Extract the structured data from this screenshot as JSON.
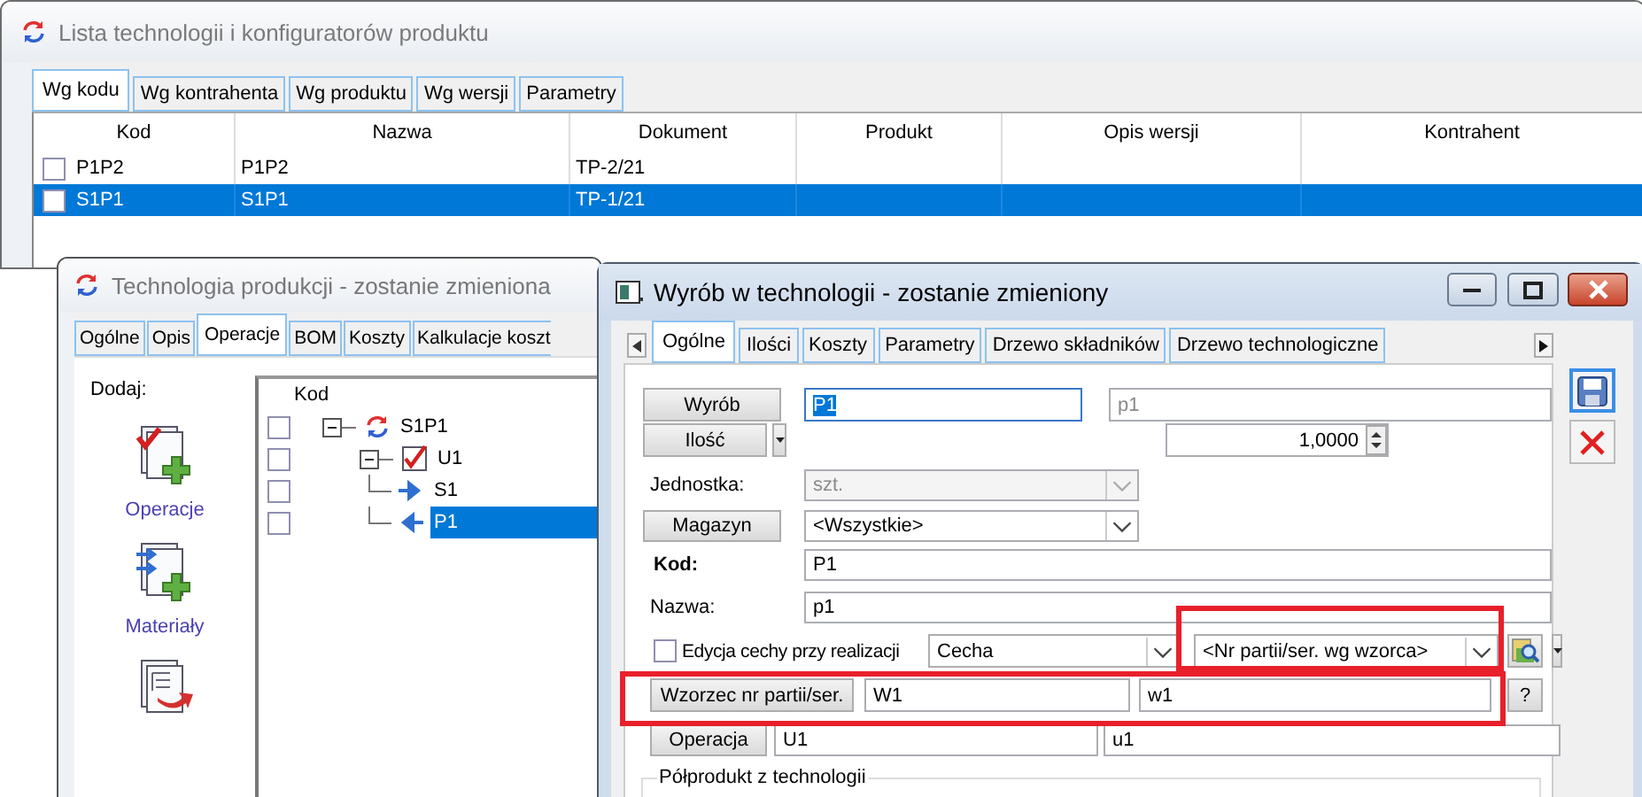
{
  "list_window": {
    "title": "Lista technologii i konfiguratorów produktu",
    "tabs": [
      {
        "label": "Wg kodu",
        "selected": true
      },
      {
        "label": "Wg kontrahenta",
        "selected": false
      },
      {
        "label": "Wg produktu",
        "selected": false
      },
      {
        "label": "Wg wersji",
        "selected": false
      },
      {
        "label": "Parametry",
        "selected": false
      }
    ],
    "table": {
      "columns": [
        "Kod",
        "Nazwa",
        "Dokument",
        "Produkt",
        "Opis wersji",
        "Kontrahent"
      ],
      "rows": [
        {
          "checked": false,
          "selected": false,
          "cells": [
            "P1P2",
            "P1P2",
            "TP-2/21",
            "",
            "",
            ""
          ]
        },
        {
          "checked": false,
          "selected": true,
          "cells": [
            "S1P1",
            "S1P1",
            "TP-1/21",
            "",
            "",
            ""
          ]
        }
      ]
    }
  },
  "technology_window": {
    "title": "Technologia produkcji - zostanie zmieniona",
    "tabs": [
      {
        "label": "Ogólne",
        "selected": false
      },
      {
        "label": "Opis",
        "selected": false
      },
      {
        "label": "Operacje",
        "selected": true
      },
      {
        "label": "BOM",
        "selected": false
      },
      {
        "label": "Koszty",
        "selected": false
      },
      {
        "label": "Kalkulacje koszt",
        "selected": false
      }
    ],
    "add_label": "Dodaj:",
    "add_actions": [
      {
        "kind": "operation",
        "label": "Operacje"
      },
      {
        "kind": "material",
        "label": "Materiały"
      },
      {
        "kind": "report"
      }
    ],
    "tree": {
      "column": "Kod",
      "nodes": [
        {
          "label": "S1P1",
          "kind": "technology",
          "checked": false,
          "selected": false,
          "expanded": true,
          "children": [
            {
              "label": "U1",
              "kind": "operation",
              "checked": false,
              "selected": false,
              "expanded": true,
              "children": [
                {
                  "label": "S1",
                  "kind": "input",
                  "checked": false,
                  "selected": false
                },
                {
                  "label": "P1",
                  "kind": "output",
                  "checked": false,
                  "selected": true
                }
              ]
            }
          ]
        }
      ]
    }
  },
  "product_window": {
    "title": "Wyrób w technologii - zostanie zmieniony",
    "tabs": [
      {
        "label": "Ogólne",
        "selected": true
      },
      {
        "label": "Ilości",
        "selected": false
      },
      {
        "label": "Koszty",
        "selected": false
      },
      {
        "label": "Parametry",
        "selected": false
      },
      {
        "label": "Drzewo składników",
        "selected": false
      },
      {
        "label": "Drzewo technologiczne",
        "selected": false
      }
    ],
    "product": {
      "button": "Wyrób",
      "code": "P1",
      "code_selected": true,
      "name": "p1",
      "name_disabled": true
    },
    "quantity": {
      "button": "Ilość",
      "value": "1,0000"
    },
    "unit": {
      "label": "Jednostka:",
      "value": "szt.",
      "disabled": true
    },
    "warehouse": {
      "button": "Magazyn",
      "value": "<Wszystkie>"
    },
    "code": {
      "label": "Kod:",
      "value": "P1"
    },
    "name": {
      "label": "Nazwa:",
      "value": "p1"
    },
    "feature_edit": {
      "label": "Edycja cechy przy realizacji",
      "checked": false,
      "feature": "Cecha",
      "batch_pattern": "<Nr partii/ser. wg wzorca>"
    },
    "pattern": {
      "button": "Wzorzec nr partii/ser.",
      "code": "W1",
      "name": "w1",
      "help": "?"
    },
    "operation": {
      "button": "Operacja",
      "code": "U1",
      "name": "u1"
    },
    "group_title": "Półprodukt z technologii"
  }
}
